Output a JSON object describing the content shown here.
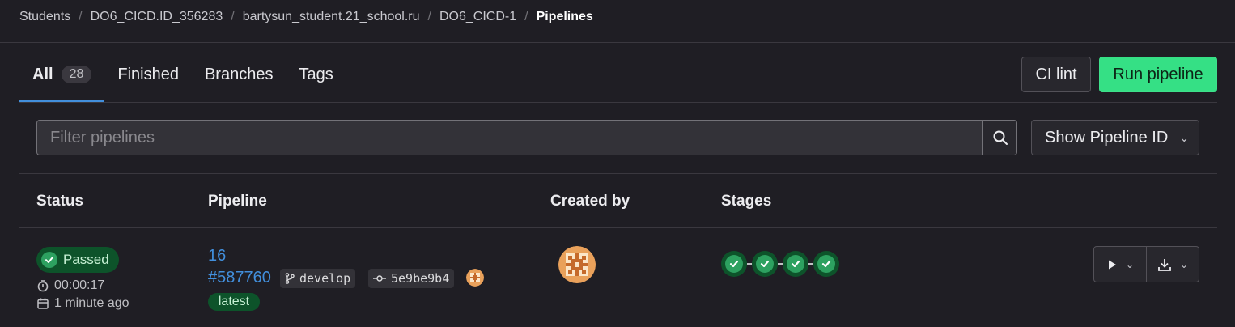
{
  "breadcrumb": {
    "items": [
      "Students",
      "DO6_CICD.ID_356283",
      "bartysun_student.21_school.ru",
      "DO6_CICD-1"
    ],
    "current": "Pipelines"
  },
  "tabs": [
    {
      "label": "All",
      "count": "28"
    },
    {
      "label": "Finished"
    },
    {
      "label": "Branches"
    },
    {
      "label": "Tags"
    }
  ],
  "buttons": {
    "ci_lint": "CI lint",
    "run_pipeline": "Run pipeline",
    "show_pipeline_id": "Show Pipeline ID"
  },
  "filter": {
    "placeholder": "Filter pipelines"
  },
  "table": {
    "headers": [
      "Status",
      "Pipeline",
      "Created by",
      "Stages"
    ],
    "rows": [
      {
        "status": "Passed",
        "duration": "00:00:17",
        "finished": "1 minute ago",
        "pipeline_number": "16",
        "pipeline_id": "#587760",
        "ref": "develop",
        "commit": "5e9be9b4",
        "tag": "latest",
        "stages": [
          "passed",
          "passed",
          "passed",
          "passed"
        ]
      }
    ]
  },
  "colors": {
    "accent": "#428fdc",
    "success": "#2da160",
    "run_button": "#35e085",
    "background": "#1f1e24"
  }
}
